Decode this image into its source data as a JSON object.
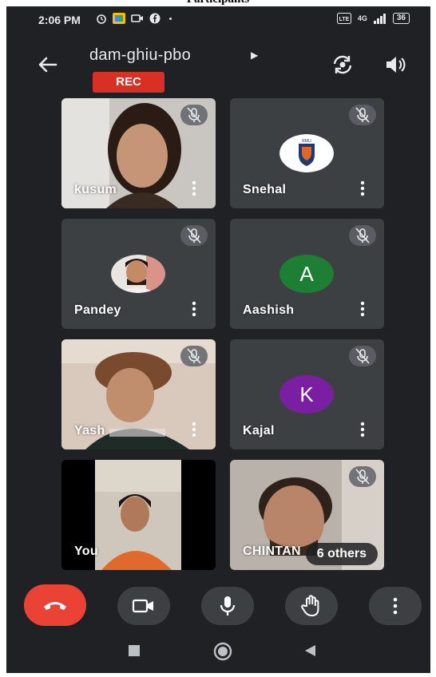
{
  "page_header_text": "Participants",
  "status_bar": {
    "time": "2:06 PM",
    "network": "4G",
    "battery": "36"
  },
  "meeting": {
    "title": "dam-ghiu-pbo",
    "recording_label": "REC"
  },
  "participants": [
    {
      "name": "kusum",
      "type": "video",
      "muted": true
    },
    {
      "name": "Snehal",
      "type": "logo",
      "muted": true,
      "logo_text": "RMU"
    },
    {
      "name": "Pandey",
      "type": "photo",
      "muted": true
    },
    {
      "name": "Aashish",
      "type": "initial",
      "initial": "A",
      "color": "#1e7f34",
      "muted": true
    },
    {
      "name": "Yash",
      "type": "video",
      "muted": true
    },
    {
      "name": "Kajal",
      "type": "initial",
      "initial": "K",
      "color": "#7b1fa2",
      "muted": true
    },
    {
      "name": "You",
      "type": "video",
      "muted": false
    },
    {
      "name": "CHINTAN",
      "type": "video",
      "muted": true
    }
  ],
  "others_label": "6 others",
  "controls": [
    "end-call",
    "camera",
    "microphone",
    "raise-hand",
    "more-options"
  ],
  "colors": {
    "background": "#202124",
    "tile": "#3c4043",
    "end_call": "#ea4335",
    "rec": "#d93025"
  }
}
